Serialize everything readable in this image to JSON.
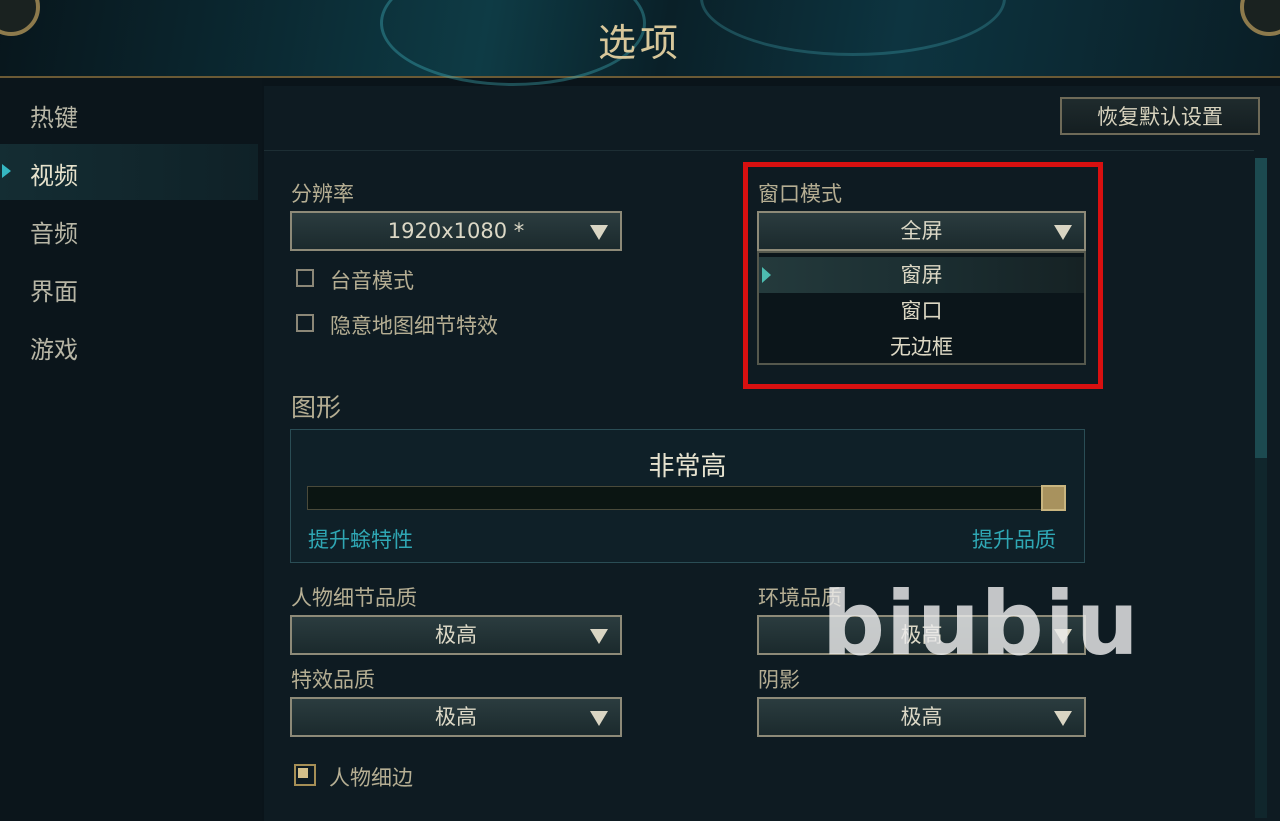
{
  "window": {
    "title": "选项"
  },
  "sidebar": {
    "items": [
      {
        "label": "热键",
        "active": false
      },
      {
        "label": "视频",
        "active": true
      },
      {
        "label": "音频",
        "active": false
      },
      {
        "label": "界面",
        "active": false
      },
      {
        "label": "游戏",
        "active": false
      }
    ]
  },
  "toolbar": {
    "reset_label": "恢复默认设置"
  },
  "resolution": {
    "label": "分辨率",
    "value": "1920x1080 *"
  },
  "checkboxes": {
    "colorblind_label": "台音模式",
    "hide_map_effects_label": "隐意地图细节特效"
  },
  "window_mode": {
    "label": "窗口模式",
    "value": "全屏",
    "options": [
      "窗屏",
      "窗口",
      "无边框"
    ],
    "highlighted_index": 0
  },
  "graphics": {
    "heading": "图形",
    "level_label": "非常高",
    "level_fraction": 1.0,
    "left_hint": "提升蜍特性",
    "right_hint": "提升品质"
  },
  "quality": {
    "character_label": "人物细节品质",
    "character_value": "极高",
    "environment_label": "环境品质",
    "environment_value": "极高",
    "effects_label": "特效品质",
    "effects_value": "极高",
    "shadow_label": "阴影",
    "shadow_value": "极高"
  },
  "character_outline": {
    "label": "人物细边",
    "checked": true
  },
  "watermark": {
    "text": "biubiu"
  },
  "colors": {
    "accent": "#35b7c2",
    "highlight_box": "#d81010",
    "gold": "#d8c79a"
  }
}
